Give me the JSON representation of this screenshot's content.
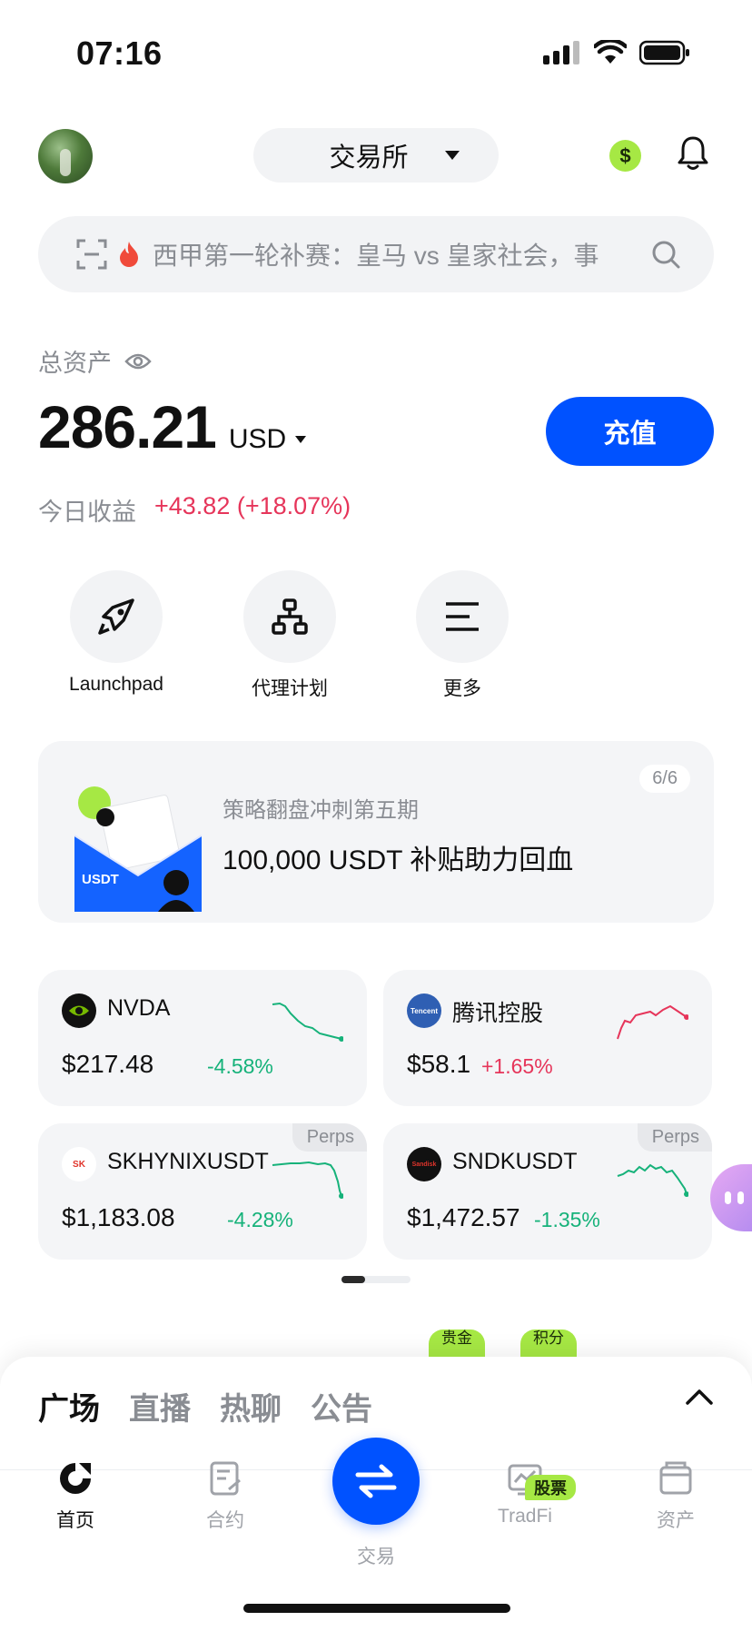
{
  "status_bar": {
    "time": "07:16"
  },
  "header": {
    "exchange_label": "交易所"
  },
  "search": {
    "text": "西甲第一轮补赛：皇马 vs 皇家社会，事"
  },
  "assets": {
    "total_label": "总资产",
    "balance": "286.21",
    "currency": "USD",
    "deposit_label": "充值",
    "today_label": "今日收益",
    "today_value": "+43.82 (+18.07%)"
  },
  "quick_actions": [
    {
      "label": "Launchpad",
      "icon": "rocket-icon"
    },
    {
      "label": "代理计划",
      "icon": "org-chart-icon"
    },
    {
      "label": "更多",
      "icon": "menu-icon"
    }
  ],
  "banner": {
    "counter": "6/6",
    "subtitle": "策略翻盘冲刺第五期",
    "title": "100,000 USDT 补贴助力回血",
    "envelope_text": "USDT"
  },
  "tickers": [
    {
      "name": "NVDA",
      "price": "$217.48",
      "change": "-4.58%",
      "direction": "down",
      "perps": ""
    },
    {
      "name": "腾讯控股",
      "price": "$58.1",
      "change": "+1.65%",
      "direction": "up",
      "perps": ""
    },
    {
      "name": "SKHYNIXUSDT",
      "price": "$1,183.08",
      "change": "-4.28%",
      "direction": "down",
      "perps": "Perps"
    },
    {
      "name": "SNDKUSDT",
      "price": "$1,472.57",
      "change": "-1.35%",
      "direction": "down",
      "perps": "Perps"
    }
  ],
  "peek_tags": [
    "贵金",
    "积分"
  ],
  "feed": {
    "tabs": [
      "广场",
      "直播",
      "热聊",
      "公告"
    ],
    "active_tab": 0
  },
  "bottom_nav": {
    "items": [
      {
        "label": "首页",
        "icon": "home-icon"
      },
      {
        "label": "合约",
        "icon": "contract-icon"
      },
      {
        "label": "交易",
        "icon": "trade-swap-icon"
      },
      {
        "label": "TradFi",
        "icon": "tradfi-chart-icon"
      },
      {
        "label": "资产",
        "icon": "wallet-icon"
      }
    ],
    "stock_badge": "股票",
    "active": 0
  },
  "colors": {
    "accent": "#0052ff",
    "up": "#e6355a",
    "down": "#16b27a",
    "badge": "#a6e844"
  }
}
